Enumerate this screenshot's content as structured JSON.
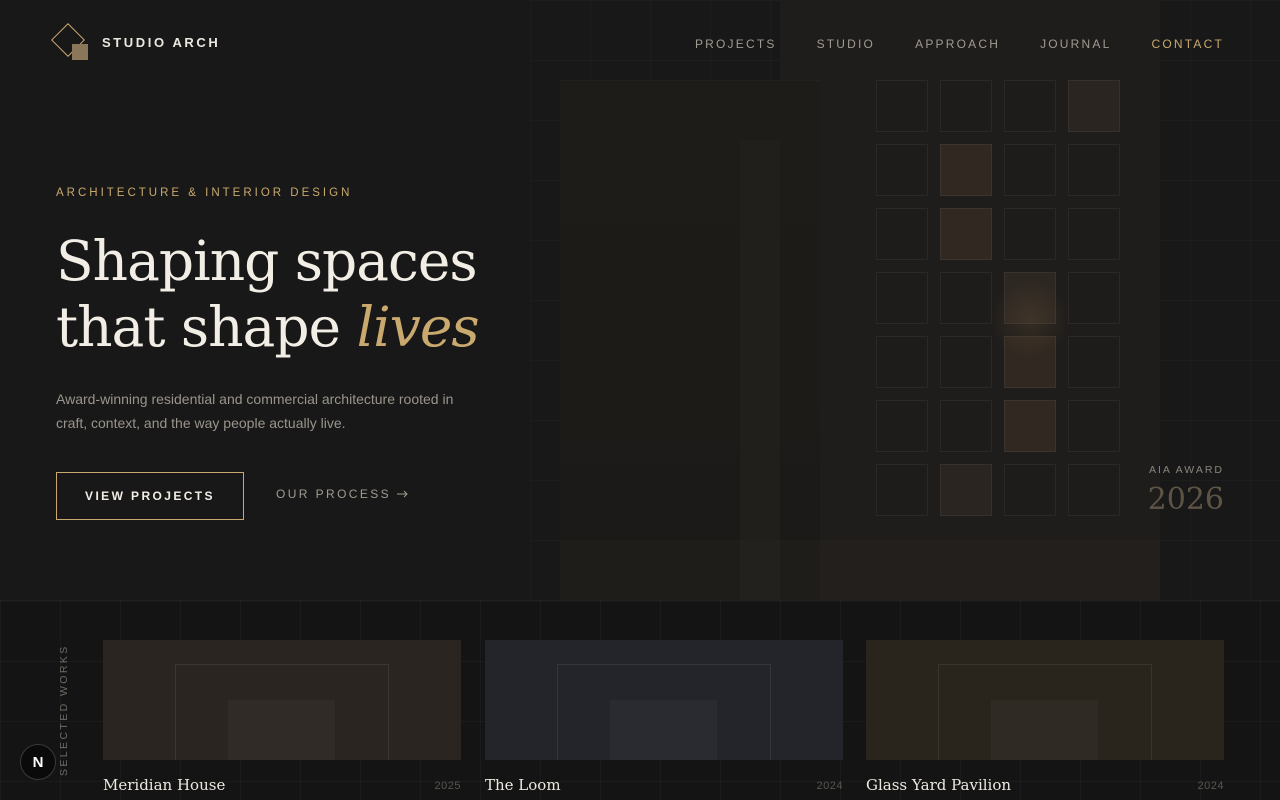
{
  "brand": {
    "name": "STUDIO ARCH",
    "logo_icon": "diamond-logo-icon"
  },
  "nav": {
    "items": [
      {
        "label": "PROJECTS"
      },
      {
        "label": "STUDIO"
      },
      {
        "label": "APPROACH"
      },
      {
        "label": "JOURNAL"
      },
      {
        "label": "CONTACT",
        "active": true
      }
    ]
  },
  "hero": {
    "eyebrow": "ARCHITECTURE & INTERIOR DESIGN",
    "headline_line1": "Shaping spaces",
    "headline_line2": "that shape",
    "headline_accent": "lives",
    "subtext": "Award-winning residential and commercial architecture rooted in craft, context, and the way people actually live.",
    "primary_cta": "VIEW PROJECTS",
    "secondary_cta": "OUR PROCESS",
    "secondary_cta_icon": "arrow-right-icon"
  },
  "award": {
    "label": "AIA AWARD",
    "year": "2026"
  },
  "works": {
    "section_label": "SELECTED WORKS",
    "items": [
      {
        "name": "Meridian House",
        "year": "2025",
        "tone": "#2a2520"
      },
      {
        "name": "The Loom",
        "year": "2024",
        "tone": "#23252b"
      },
      {
        "name": "Glass Yard Pavilion",
        "year": "2024",
        "tone": "#29241c"
      }
    ]
  },
  "floating_badge": {
    "label": "N"
  },
  "colors": {
    "accent": "#c9a96e",
    "background": "#161616",
    "text": "#f2eee6"
  }
}
